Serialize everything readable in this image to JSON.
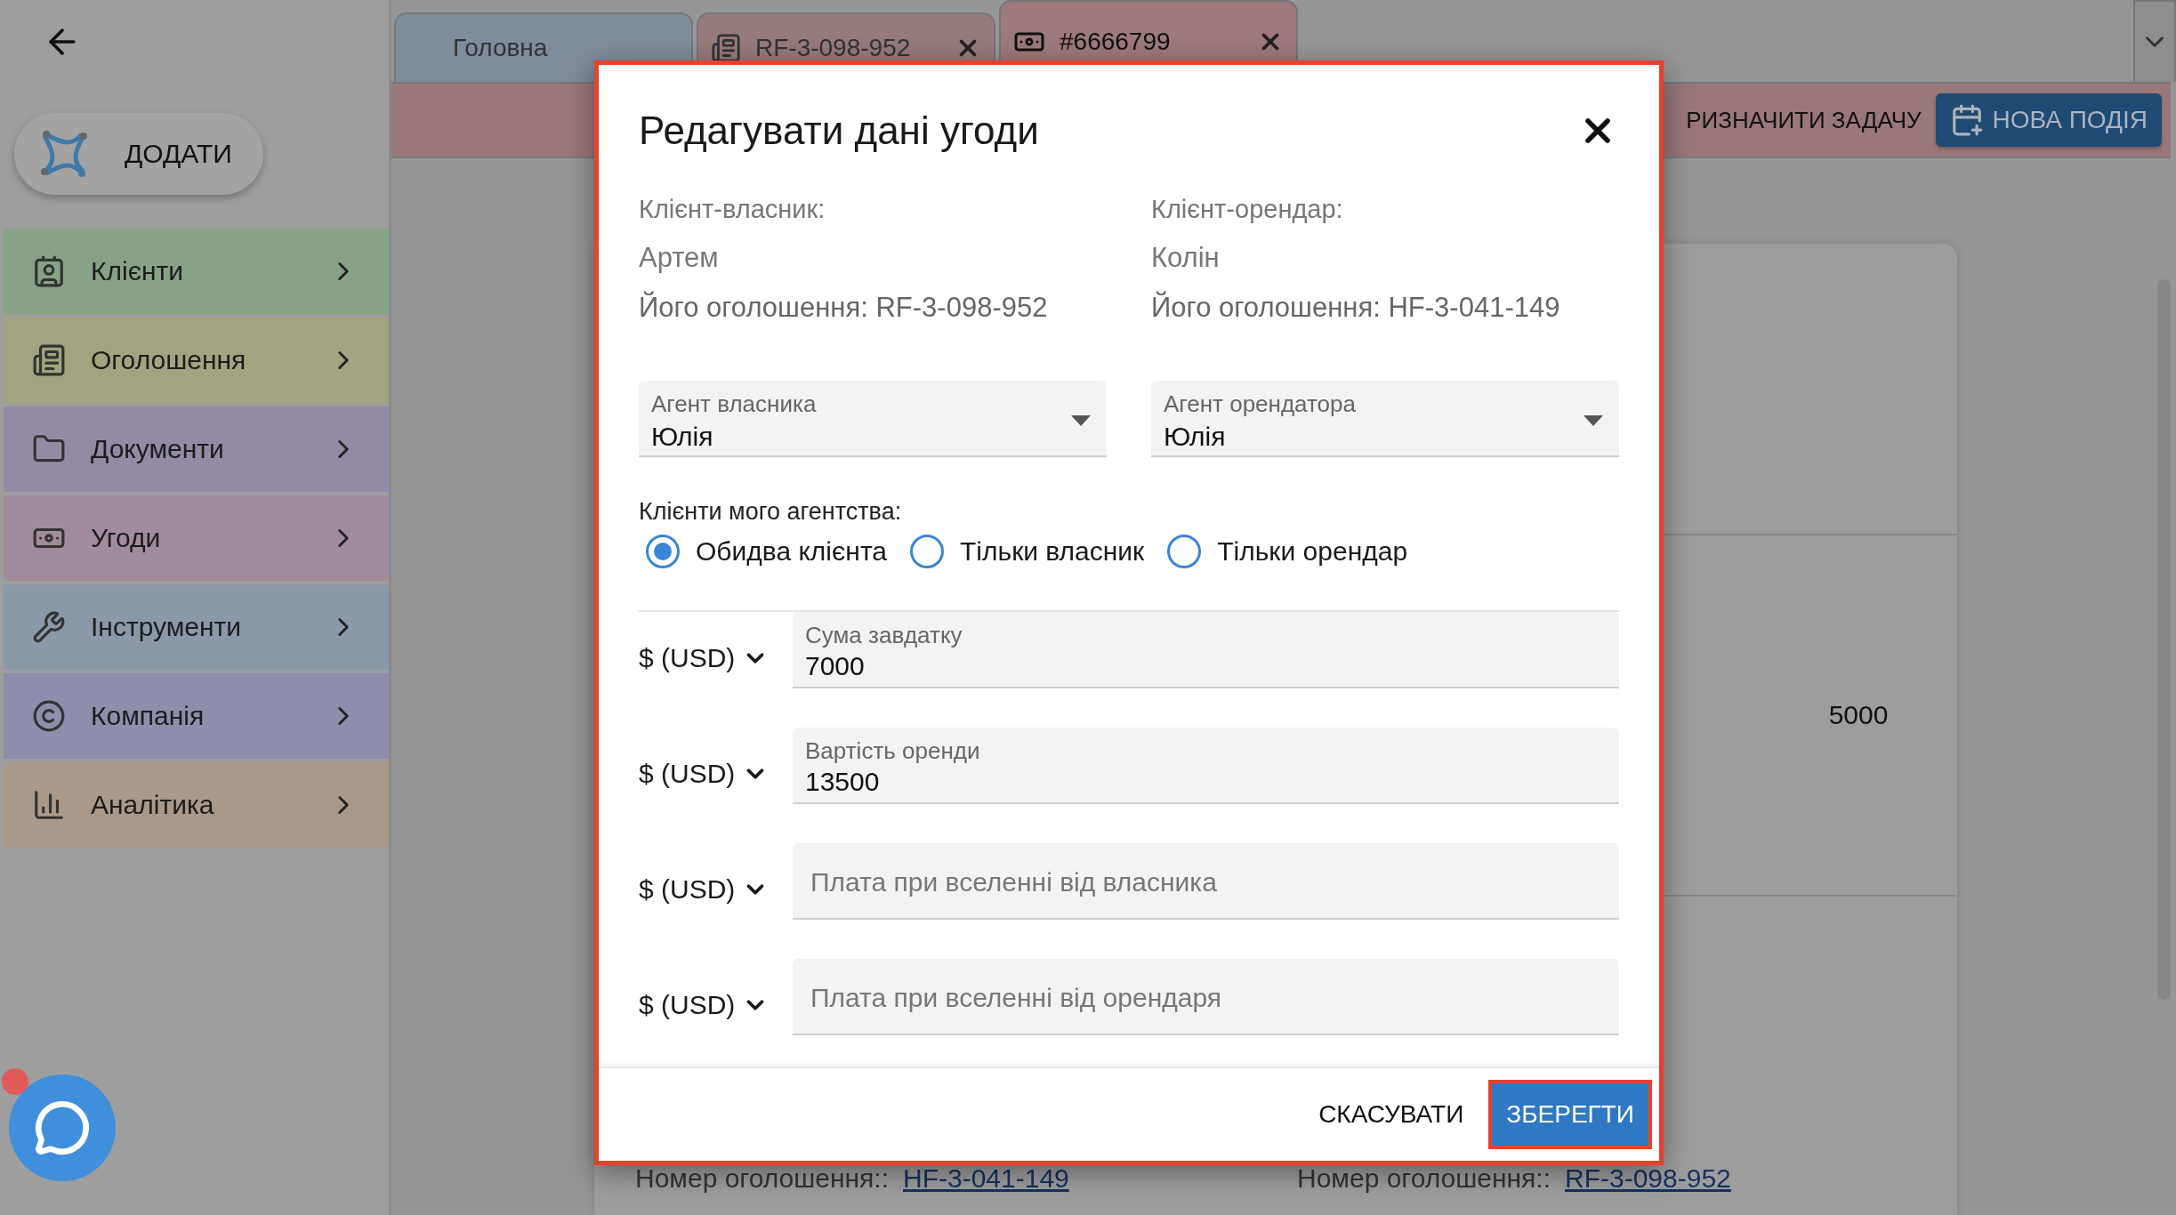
{
  "sidebar": {
    "add_button": "ДОДАТИ",
    "items": [
      {
        "label": "Клієнти",
        "color": "#87a287"
      },
      {
        "label": "Оголошення",
        "color": "#a2a47f"
      },
      {
        "label": "Документи",
        "color": "#938ba4"
      },
      {
        "label": "Угоди",
        "color": "#a08c9c"
      },
      {
        "label": "Інструменти",
        "color": "#8a98a8"
      },
      {
        "label": "Компанія",
        "color": "#8d8fac"
      },
      {
        "label": "Аналітика",
        "color": "#a8998a"
      }
    ]
  },
  "tabs": [
    {
      "label": "Головна",
      "kind": "home",
      "selected": false,
      "closable": false
    },
    {
      "label": "RF-3-098-952",
      "kind": "listing",
      "selected": false,
      "closable": true
    },
    {
      "label": "#6666799",
      "kind": "deal",
      "selected": true,
      "closable": true
    }
  ],
  "action_bar": {
    "buttons": [
      {
        "label": "РИЗНАЧИТИ ЗАДАЧУ",
        "kind": "text"
      },
      {
        "label": "НОВА ПОДІЯ",
        "kind": "primary"
      }
    ]
  },
  "content": {
    "value": "5000",
    "listings": [
      {
        "label": "Номер оголошення::",
        "link": "HF-3-041-149"
      },
      {
        "label": "Номер оголошення::",
        "link": "RF-3-098-952"
      }
    ]
  },
  "dialog": {
    "title": "Редагувати дані угоди",
    "clients": [
      {
        "label": "Клієнт-власник:",
        "name": "Артем",
        "listing": "Його оголошення: RF-3-098-952"
      },
      {
        "label": "Клієнт-орендар:",
        "name": "Колін",
        "listing": "Його оголошення: HF-3-041-149"
      }
    ],
    "agents": [
      {
        "label": "Агент власника",
        "value": "Юлія"
      },
      {
        "label": "Агент орендатора",
        "value": "Юлія"
      }
    ],
    "radio_label": "Клієнти мого агентства:",
    "radios": [
      {
        "label": "Обидва клієнта",
        "selected": true
      },
      {
        "label": "Тільки власник",
        "selected": false
      },
      {
        "label": "Тільки орендар",
        "selected": false
      }
    ],
    "amounts": [
      {
        "currency": "$ (USD)",
        "label": "Сума завдатку",
        "value": "7000"
      },
      {
        "currency": "$ (USD)",
        "label": "Вартість оренди",
        "value": "13500"
      },
      {
        "currency": "$ (USD)",
        "placeholder": "Плата при вселенні від власника"
      },
      {
        "currency": "$ (USD)",
        "placeholder": "Плата при вселенні від орендаря"
      }
    ],
    "buttons": [
      {
        "label": "СКАСУВАТИ",
        "kind": "text"
      },
      {
        "label": "ЗБЕРЕГТИ",
        "kind": "primary"
      }
    ]
  }
}
